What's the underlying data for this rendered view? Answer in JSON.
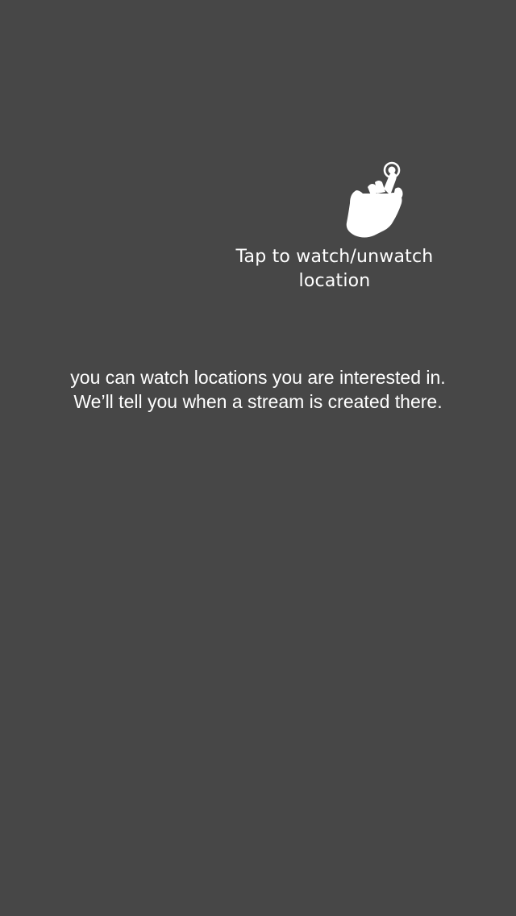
{
  "overlay": {
    "background_color": "#474747",
    "text_color": "#ffffff"
  },
  "tap_hint": {
    "icon": "tap-hand-icon",
    "label": "Tap to watch/unwatch\nlocation"
  },
  "explanation": {
    "text": "you can watch locations you are interested in.\nWe’ll tell you when a stream is created there."
  }
}
